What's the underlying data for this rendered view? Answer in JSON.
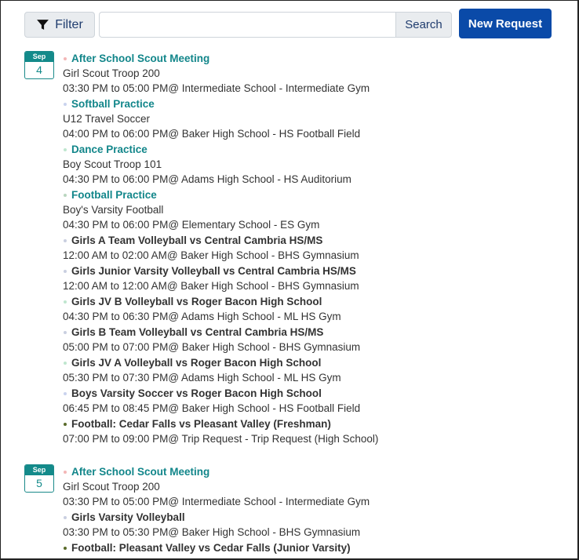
{
  "toolbar": {
    "filter_label": "Filter",
    "search_placeholder": "",
    "search_value": "",
    "search_label": "Search",
    "new_request_label": "New Request"
  },
  "days": [
    {
      "month": "Sep",
      "day": "4",
      "events": [
        {
          "title": "After School Scout Meeting",
          "style": "link",
          "dot_color": "#f3b6b6",
          "group": "Girl Scout Troop 200",
          "time_location": "03:30 PM to 05:00 PM@ Intermediate School - Intermediate Gym"
        },
        {
          "title": "Softball Practice",
          "style": "link",
          "dot_color": "#c9d3ee",
          "group": "U12 Travel Soccer",
          "time_location": "04:00 PM to 06:00 PM@ Baker High School - HS Football Field"
        },
        {
          "title": "Dance Practice",
          "style": "link",
          "dot_color": "#bfe6cf",
          "group": "Boy Scout Troop 101",
          "time_location": "04:30 PM to 06:00 PM@ Adams High School - HS Auditorium"
        },
        {
          "title": "Football Practice",
          "style": "link",
          "dot_color": "#b9d6bf",
          "group": "Boy's Varsity Football",
          "time_location": "04:30 PM to 06:00 PM@ Elementary School - ES Gym"
        },
        {
          "title": "Girls A Team Volleyball vs Central Cambria HS/MS",
          "style": "bold",
          "dot_color": "#c9cfe0",
          "time_location": "12:00 AM to 02:00 AM@ Baker High School - BHS Gymnasium"
        },
        {
          "title": "Girls Junior Varsity Volleyball vs Central Cambria HS/MS",
          "style": "bold",
          "dot_color": "#c9cfe0",
          "time_location": "12:00 AM to 12:00 AM@ Baker High School - BHS Gymnasium"
        },
        {
          "title": "Girls JV B Volleyball vs Roger Bacon High School",
          "style": "bold",
          "dot_color": "#bfe6cf",
          "time_location": "04:30 PM to 06:30 PM@ Adams High School - ML HS Gym"
        },
        {
          "title": "Girls B Team Volleyball vs Central Cambria HS/MS",
          "style": "bold",
          "dot_color": "#c9cfe0",
          "time_location": "05:00 PM to 07:00 PM@ Baker High School - BHS Gymnasium"
        },
        {
          "title": "Girls JV A Volleyball vs Roger Bacon High School",
          "style": "bold",
          "dot_color": "#bfe6cf",
          "time_location": "05:30 PM to 07:30 PM@ Adams High School - ML HS Gym"
        },
        {
          "title": "Boys Varsity Soccer vs Roger Bacon High School",
          "style": "bold",
          "dot_color": "#c9d3ee",
          "time_location": "06:45 PM to 08:45 PM@ Baker High School - HS Football Field"
        },
        {
          "title": "Football: Cedar Falls vs Pleasant Valley (Freshman)",
          "style": "bold",
          "dot_color": "#5a6b2a",
          "time_location": "07:00 PM to 09:00 PM@ Trip Request - Trip Request (High School)"
        }
      ]
    },
    {
      "month": "Sep",
      "day": "5",
      "events": [
        {
          "title": "After School Scout Meeting",
          "style": "link",
          "dot_color": "#f3b6b6",
          "group": "Girl Scout Troop 200",
          "time_location": "03:30 PM to 05:00 PM@ Intermediate School - Intermediate Gym"
        },
        {
          "title": "Girls Varsity Volleyball",
          "style": "bold",
          "dot_color": "#c9cfe0",
          "time_location": "03:30 PM to 05:30 PM@ Baker High School - BHS Gymnasium"
        },
        {
          "title": "Football: Pleasant Valley vs Cedar Falls (Junior Varsity)",
          "style": "bold",
          "dot_color": "#5a6b2a"
        }
      ]
    }
  ]
}
